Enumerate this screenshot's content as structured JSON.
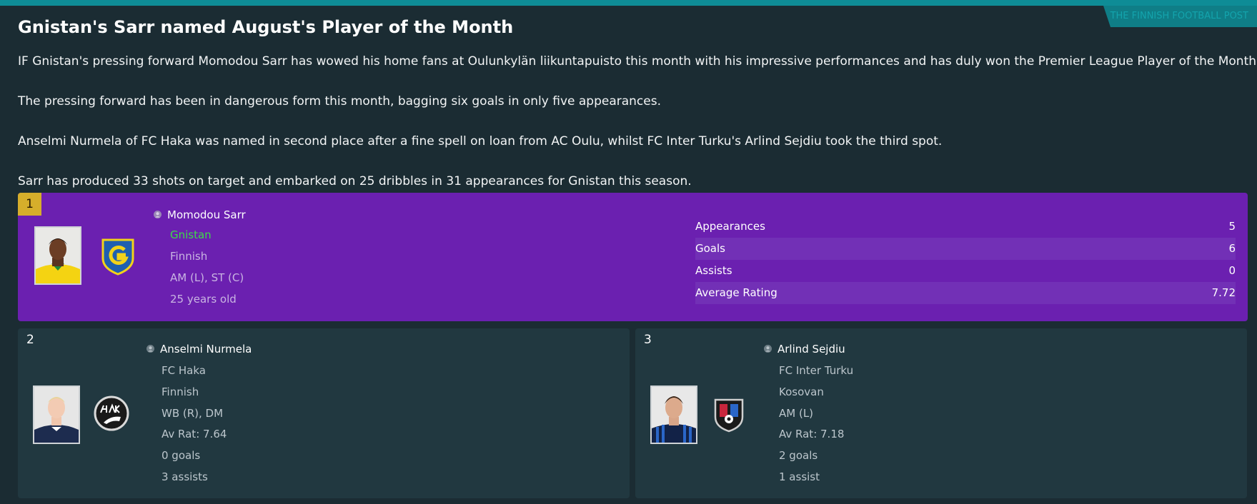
{
  "source": "THE FINNISH FOOTBALL POST",
  "headline": "Gnistan's Sarr named August's Player of the Month",
  "paragraphs": [
    "IF Gnistan's pressing forward Momodou Sarr has wowed his home fans at Oulunkylän liikuntapuisto this month with his impressive performances and has duly won the Premier League Player of the Month.",
    "The pressing forward has been in dangerous form this month, bagging six goals in only five appearances.",
    "Anselmi Nurmela of FC Haka was named in second place after a fine spell on loan from AC Oulu, whilst FC Inter Turku's Arlind Sejdiu took the third spot.",
    "Sarr has produced 33 shots on target and embarked on 25 dribbles in 31 appearances for Gnistan this season."
  ],
  "winner": {
    "rank": "1",
    "name": "Momodou Sarr",
    "club": "Gnistan",
    "nationality": "Finnish",
    "position": "AM (L), ST (C)",
    "age": "25 years old",
    "stats": [
      {
        "label": "Appearances",
        "value": "5"
      },
      {
        "label": "Goals",
        "value": "6"
      },
      {
        "label": "Assists",
        "value": "0"
      },
      {
        "label": "Average Rating",
        "value": "7.72"
      }
    ],
    "club_color": "#1f5fb0",
    "crest_accent": "#f2d21a"
  },
  "runners": [
    {
      "rank": "2",
      "name": "Anselmi Nurmela",
      "club": "FC Haka",
      "nationality": "Finnish",
      "position": "WB (R), DM",
      "rating": "Av Rat: 7.64",
      "goals": "0 goals",
      "assists": "3 assists"
    },
    {
      "rank": "3",
      "name": "Arlind Sejdiu",
      "club": "FC Inter Turku",
      "nationality": "Kosovan",
      "position": "AM (L)",
      "rating": "Av Rat: 7.18",
      "goals": "2 goals",
      "assists": "1 assist"
    }
  ],
  "icons": {
    "person": "person-icon",
    "gnistan_crest": "gnistan-crest-icon",
    "haka_crest": "haka-crest-icon",
    "inter_turku_crest": "inter-turku-crest-icon"
  }
}
